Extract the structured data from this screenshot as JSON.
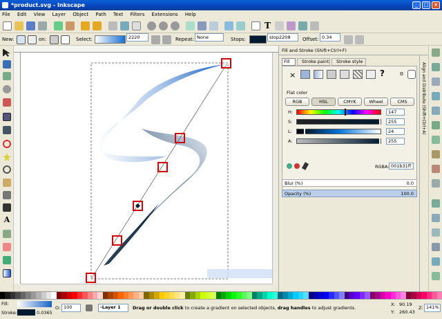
{
  "window": {
    "title": "*product.svg - Inkscape"
  },
  "menu": [
    "File",
    "Edit",
    "View",
    "Layer",
    "Object",
    "Path",
    "Text",
    "Filters",
    "Extensions",
    "Help"
  ],
  "controls": {
    "new_label": "New:",
    "on_label": "on:",
    "select_label": "Select:",
    "gradient_name": "2220",
    "repeat_label": "Repeat:",
    "repeat_value": "None",
    "stops_label": "Stops:",
    "stop_name": "stop2208",
    "offset_label": "Offset:",
    "offset_value": "0.34"
  },
  "dialog": {
    "title": "Fill and Stroke (Shift+Ctrl+F)",
    "tabs": [
      "Fill",
      "Stroke paint",
      "Stroke style"
    ],
    "flat_color_label": "Flat color",
    "modes": [
      "RGB",
      "HSL",
      "CMYK",
      "Wheel",
      "CMS"
    ],
    "channels": [
      {
        "label": "H:",
        "value": "147",
        "level": 0.58
      },
      {
        "label": "S:",
        "value": "255",
        "level": 1.0
      },
      {
        "label": "L:",
        "value": "24",
        "level": 0.09
      },
      {
        "label": "A:",
        "value": "255",
        "level": 1.0
      }
    ],
    "rgba_label": "RGBA:",
    "rgba_value": "001b31ff",
    "blur_label": "Blur (%)",
    "blur_value": "0.0",
    "opacity_label": "Opacity (%)",
    "opacity_value": "100.0",
    "side_tab": "Align and Distribute (Shift+Ctrl+A)"
  },
  "status": {
    "fill_label": "Fill:",
    "stroke_label": "Stroke:",
    "stroke_width": "0.0365",
    "opacity_label": "O:",
    "opacity_value": "100",
    "layer": "-Layer 1",
    "message_pre": "Drag or ",
    "message_b1": "double click",
    "message_mid": " to create a gradient on selected objects, ",
    "message_b2": "drag handles",
    "message_post": " to adjust gradients.",
    "x_label": "X:",
    "x_value": "90.19",
    "y_label": "Y:",
    "y_value": "260.43",
    "zoom_label": "Z:",
    "zoom_value": "141%"
  },
  "colors": {
    "accent": "#0a5fd8",
    "current_fill": "#001b31",
    "gradient_blue": "#1a6fd0"
  }
}
